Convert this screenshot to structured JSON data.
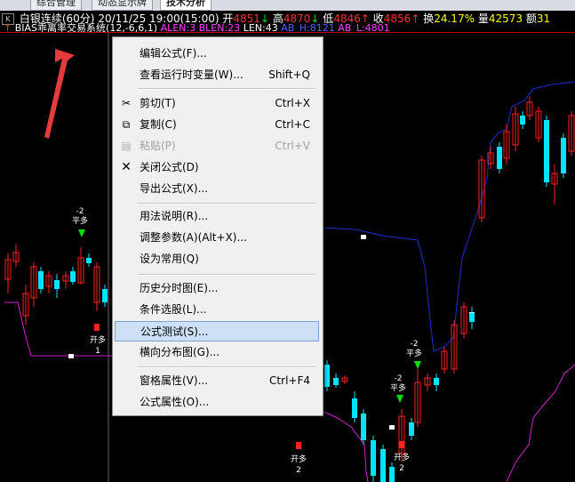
{
  "tabs": [
    "综合管理",
    "动态显示牌",
    "技术分析"
  ],
  "info": {
    "k_button": "K",
    "name": "白银连续",
    "period": "(60分)",
    "datetime": "20/11/25 19:00(15:00)",
    "open_label": "开",
    "open_value": "4851",
    "high_label": "高",
    "high_value": "4870",
    "low_label": "低",
    "low_value": "4846",
    "close_label": "收",
    "close_value": "4856",
    "turnover_label": "换",
    "turnover_value": "24.17%",
    "volume_label": "量",
    "volume_value": "42573",
    "amount_label": "额",
    "amount_value": "31"
  },
  "formula": {
    "name": "BIAS乖离率交易系统",
    "params": "(12,-6,6,1)",
    "alen": "ALEN:3",
    "blen": "BLEN:23",
    "len": "LEN:43",
    "ab_h": "AB_H:8121",
    "ab_l": "AB_L:4801"
  },
  "menu": {
    "items": [
      {
        "label": "编辑公式(F)...",
        "shortcut": ""
      },
      {
        "label": "查看运行时变量(W)...",
        "shortcut": "Shift+Q"
      },
      {
        "label": "剪切(T)",
        "shortcut": "Ctrl+X"
      },
      {
        "label": "复制(C)",
        "shortcut": "Ctrl+C"
      },
      {
        "label": "粘贴(P)",
        "shortcut": "Ctrl+V"
      },
      {
        "label": "关闭公式(D)",
        "shortcut": ""
      },
      {
        "label": "导出公式(X)...",
        "shortcut": ""
      },
      {
        "label": "用法说明(R)...",
        "shortcut": ""
      },
      {
        "label": "调整参数(A)(Alt+X)...",
        "shortcut": ""
      },
      {
        "label": "设为常用(Q)",
        "shortcut": ""
      },
      {
        "label": "历史分时图(E)...",
        "shortcut": ""
      },
      {
        "label": "条件选股(L)...",
        "shortcut": ""
      },
      {
        "label": "公式测试(S)...",
        "shortcut": ""
      },
      {
        "label": "横向分布图(G)...",
        "shortcut": ""
      },
      {
        "label": "窗格属性(V)...",
        "shortcut": "Ctrl+F4"
      },
      {
        "label": "公式属性(O)...",
        "shortcut": ""
      }
    ]
  },
  "chart_labels": {
    "l1": "-2",
    "l2": "平多",
    "l3": "开多",
    "l4": "1",
    "l5": "-2",
    "l6": "平多",
    "l7": "-2",
    "l8": "平多",
    "l9": "开多",
    "l10": "2",
    "l11": "开多",
    "l12": "2"
  },
  "colors": {
    "up": "#ff2020",
    "down": "#00e5ff",
    "upper_band": "#1a2fd0",
    "lower_band": "#d020d0"
  }
}
